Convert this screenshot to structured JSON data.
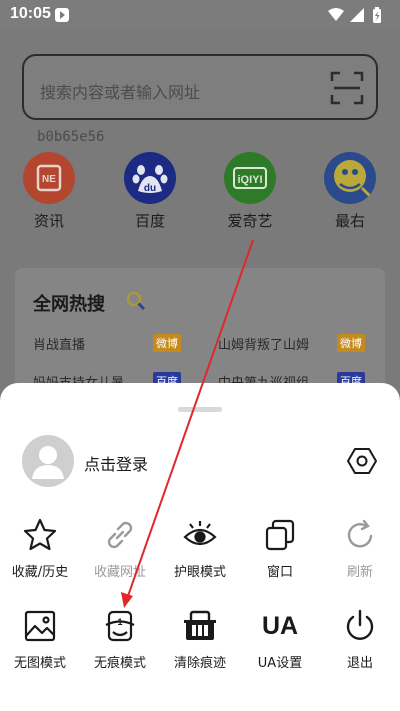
{
  "status_bar": {
    "time": "10:05"
  },
  "search": {
    "placeholder": "搜索内容或者输入网址"
  },
  "device_id": "b0b65e56",
  "shortcuts": [
    {
      "label": "资讯",
      "icon": "news-icon",
      "color": "#b9432a"
    },
    {
      "label": "百度",
      "icon": "baidu-icon",
      "color": "#1d2d8a"
    },
    {
      "label": "爱奇艺",
      "icon": "iqiyi-icon",
      "color": "#2f7a2a"
    },
    {
      "label": "最右",
      "icon": "zuiyou-icon",
      "color": "#2a4a8a"
    }
  ],
  "hot": {
    "title": "全网热搜",
    "items": [
      {
        "text": "肖战直播",
        "badge": "微博"
      },
      {
        "text": "山姆背叛了山姆",
        "badge": "微博"
      },
      {
        "text": "妈妈支持女儿暑",
        "badge": "百度"
      },
      {
        "text": "中央第九巡视组",
        "badge": "百度"
      }
    ]
  },
  "sheet": {
    "login_label": "点击登录",
    "row1": [
      {
        "label": "收藏/历史",
        "icon": "star-icon",
        "enabled": true
      },
      {
        "label": "收藏网址",
        "icon": "link-icon",
        "enabled": false
      },
      {
        "label": "护眼模式",
        "icon": "eye-icon",
        "enabled": true
      },
      {
        "label": "窗口",
        "icon": "windows-icon",
        "enabled": true
      },
      {
        "label": "刷新",
        "icon": "refresh-icon",
        "enabled": false
      }
    ],
    "row2": [
      {
        "label": "无图模式",
        "icon": "image-icon",
        "enabled": true
      },
      {
        "label": "无痕模式",
        "icon": "incognito-icon",
        "enabled": true
      },
      {
        "label": "清除痕迹",
        "icon": "clear-basket-icon",
        "enabled": true
      },
      {
        "label": "UA设置",
        "icon": "ua-icon",
        "icon_text": "UA",
        "enabled": true
      },
      {
        "label": "退出",
        "icon": "power-icon",
        "enabled": true
      }
    ]
  },
  "colors": {
    "annotation_arrow": "#e0282a",
    "badge_weibo": "#c48a1c",
    "badge_baidu": "#2a3a9a"
  }
}
